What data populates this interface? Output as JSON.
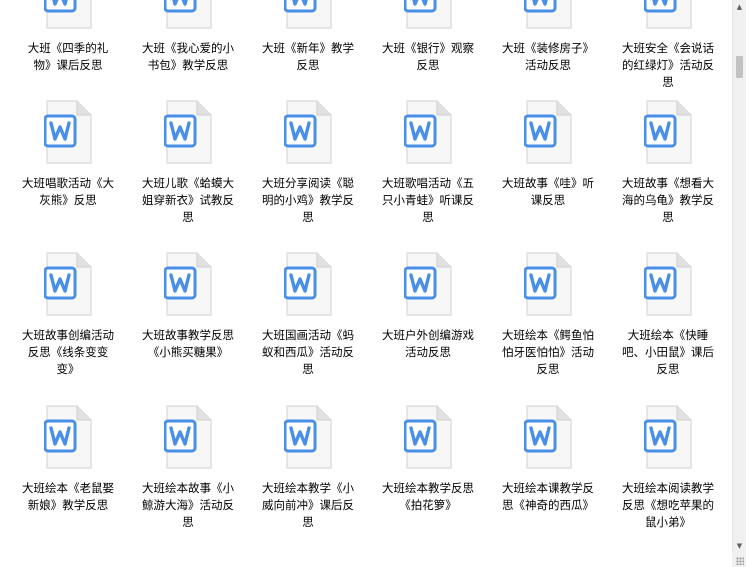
{
  "files": [
    {
      "name": "大班《四季的礼物》课后反思",
      "icon": "word-doc-icon"
    },
    {
      "name": "大班《我心爱的小书包》教学反思",
      "icon": "word-doc-icon"
    },
    {
      "name": "大班《新年》教学反思",
      "icon": "word-doc-icon"
    },
    {
      "name": "大班《银行》观察反思",
      "icon": "word-doc-icon"
    },
    {
      "name": "大班《装修房子》活动反思",
      "icon": "word-doc-icon"
    },
    {
      "name": "大班安全《会说话的红绿灯》活动反思",
      "icon": "word-doc-icon"
    },
    {
      "name": "大班唱歌活动《大灰熊》反思",
      "icon": "word-doc-icon"
    },
    {
      "name": "大班儿歌《蛤蟆大姐穿新衣》试教反思",
      "icon": "word-doc-icon"
    },
    {
      "name": "大班分享阅读《聪明的小鸡》教学反思",
      "icon": "word-doc-icon"
    },
    {
      "name": "大班歌唱活动《五只小青蛙》听课反思",
      "icon": "word-doc-icon"
    },
    {
      "name": "大班故事《哇》听课反思",
      "icon": "word-doc-icon"
    },
    {
      "name": "大班故事《想看大海的乌龟》教学反思",
      "icon": "word-doc-icon"
    },
    {
      "name": "大班故事创编活动反思《线条变变变》",
      "icon": "word-doc-icon"
    },
    {
      "name": "大班故事教学反思《小熊买糖果》",
      "icon": "word-doc-icon"
    },
    {
      "name": "大班国画活动《蚂蚁和西瓜》活动反思",
      "icon": "word-doc-icon"
    },
    {
      "name": "大班户外创编游戏活动反思",
      "icon": "word-doc-icon"
    },
    {
      "name": "大班绘本《鳄鱼怕怕牙医怕怕》活动反思",
      "icon": "word-doc-icon"
    },
    {
      "name": "大班绘本《快睡吧、小田鼠》课后反思",
      "icon": "word-doc-icon"
    },
    {
      "name": "大班绘本《老鼠娶新娘》教学反思",
      "icon": "word-doc-icon"
    },
    {
      "name": "大班绘本故事《小鲸游大海》活动反思",
      "icon": "word-doc-icon"
    },
    {
      "name": "大班绘本教学《小威向前冲》课后反思",
      "icon": "word-doc-icon"
    },
    {
      "name": "大班绘本教学反思《拍花箩》",
      "icon": "word-doc-icon"
    },
    {
      "name": "大班绘本课教学反思《神奇的西瓜》",
      "icon": "word-doc-icon"
    },
    {
      "name": "大班绘本阅读教学反思《想吃苹果的鼠小弟》",
      "icon": "word-doc-icon"
    }
  ],
  "icon_colors": {
    "accent": "#4a8fe7",
    "page": "#f7f7f7",
    "page_border": "#cfcfcf",
    "fold": "#e2e2e2"
  },
  "scrollbar": {
    "up_icon": "scroll-up-arrow-icon",
    "down_icon": "scroll-down-arrow-icon"
  }
}
